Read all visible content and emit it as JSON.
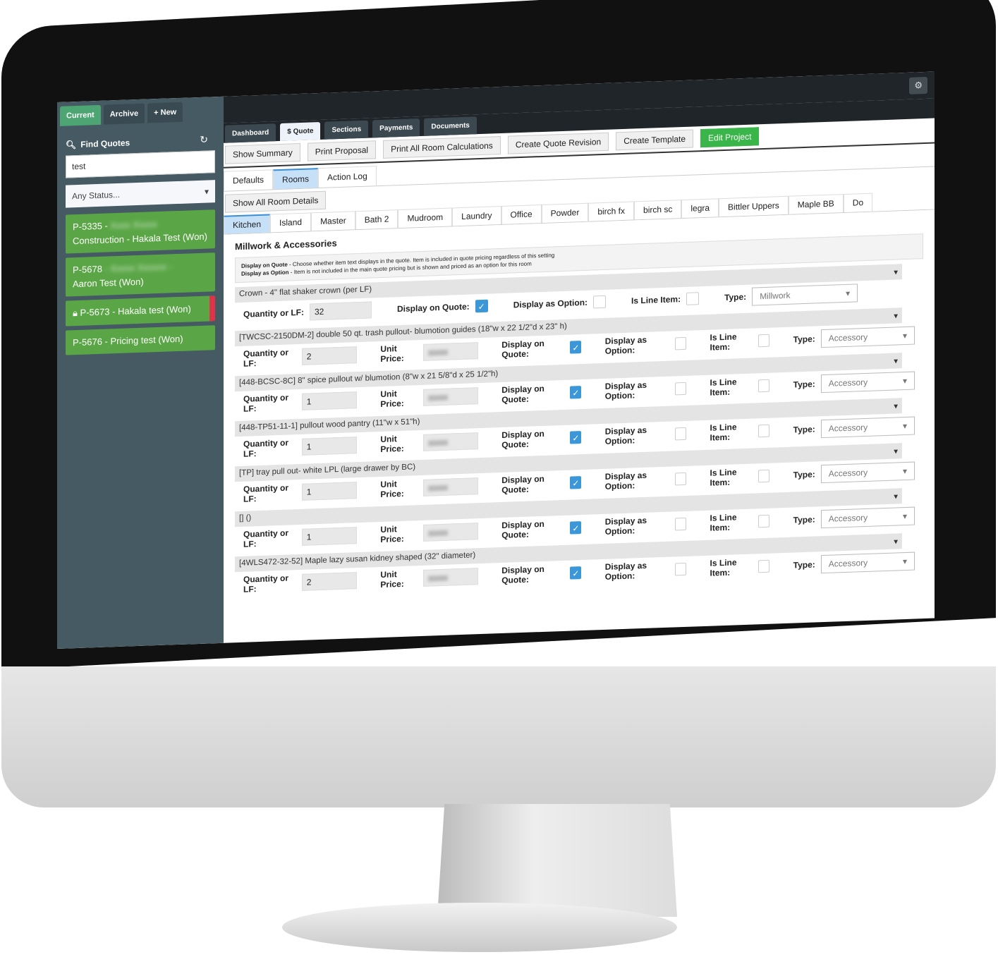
{
  "sidebar": {
    "tabs": [
      "Current",
      "Archive",
      "+ New"
    ],
    "find_label": "Find Quotes",
    "search_value": "test",
    "status_select": "Any Status...",
    "quotes": [
      {
        "id": "P-5335 -",
        "rest": "Construction - Hakala Test (Won)"
      },
      {
        "id": "P-5678",
        "rest": "Aaron Test (Won)"
      },
      {
        "id": "P-5673 - Hakala test (Won)",
        "rest": ""
      },
      {
        "id": "P-5676 - Pricing test (Won)",
        "rest": ""
      }
    ]
  },
  "nav": {
    "tabs": [
      "Dashboard",
      "$ Quote",
      "Sections",
      "Payments",
      "Documents"
    ],
    "active": "$ Quote"
  },
  "actions": [
    "Show Summary",
    "Print Proposal",
    "Print All Room Calculations",
    "Create Quote Revision",
    "Create Template",
    "Edit Project"
  ],
  "subtabs": [
    "Defaults",
    "Rooms",
    "Action Log"
  ],
  "show_all": "Show All Room Details",
  "rooms": [
    "Kitchen",
    "Island",
    "Master",
    "Bath 2",
    "Mudroom",
    "Laundry",
    "Office",
    "Powder",
    "birch fx",
    "birch sc",
    "legra",
    "Bittler Uppers",
    "Maple BB",
    "Do"
  ],
  "section_title": "Millwork & Accessories",
  "help": {
    "l1b": "Display on Quote",
    "l1": " - Choose whether item text displays in the quote. Item is included in quote pricing regardless of this setting",
    "l2b": "Display as Option",
    "l2": " - Item is not included in the main quote pricing but is shown and priced as an option for this room"
  },
  "labels": {
    "qty": "Quantity or LF:",
    "price": "Unit Price:",
    "doq": "Display on Quote:",
    "dao": "Display as Option:",
    "line": "Is Line Item:",
    "type": "Type:"
  },
  "items": [
    {
      "name": "Crown - 4\" flat shaker crown (per LF)",
      "qty": "32",
      "type": "Millwork"
    },
    {
      "name": "[TWCSC-2150DM-2] double 50 qt. trash pullout- blumotion guides (18\"w x 22 1/2\"d x 23\" h)",
      "qty": "2",
      "type": "Accessory"
    },
    {
      "name": "[448-BCSC-8C] 8\" spice pullout w/ blumotion (8\"w x 21 5/8\"d x 25 1/2\"h)",
      "qty": "1",
      "type": "Accessory"
    },
    {
      "name": "[448-TP51-11-1] pullout wood pantry (11\"w x 51\"h)",
      "qty": "1",
      "type": "Accessory"
    },
    {
      "name": "[TP] tray pull out- white LPL (large drawer by BC)",
      "qty": "1",
      "type": "Accessory"
    },
    {
      "name": "[] ()",
      "qty": "1",
      "type": "Accessory"
    },
    {
      "name": "[4WLS472-32-52] Maple lazy susan kidney shaped (32\" diameter)",
      "qty": "2",
      "type": "Accessory"
    }
  ],
  "colors": {
    "sidebar": "#465a63",
    "quote_item": "#5aa646",
    "accent": "#3b97d8",
    "edit_project": "#3ab54a"
  }
}
